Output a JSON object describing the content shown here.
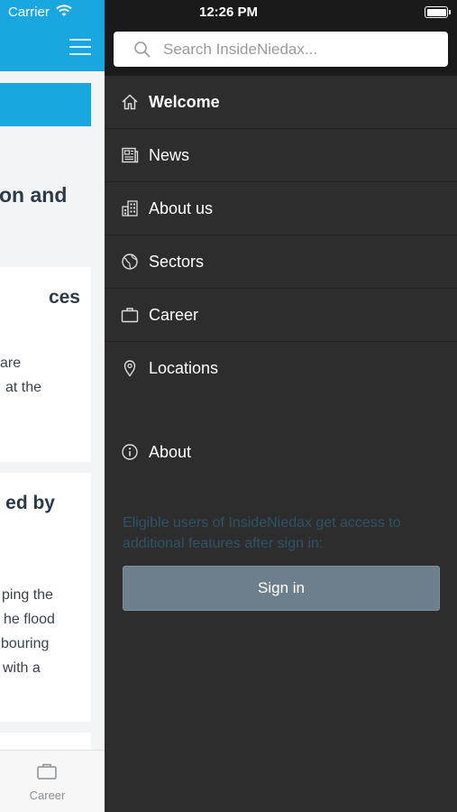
{
  "status_bar": {
    "carrier": "Carrier",
    "time": "12:26 PM"
  },
  "background_app": {
    "headline": "on and",
    "card1": {
      "title": "ces",
      "lines": [
        "are",
        "at the"
      ]
    },
    "card2": {
      "title": "ed by",
      "lines": [
        "ping the",
        "he flood",
        "bouring",
        "with a"
      ]
    },
    "tabbar": {
      "career_label": "Career"
    },
    "colors": {
      "header": "#1aa7e0"
    }
  },
  "drawer": {
    "search": {
      "placeholder": "Search InsideNiedax..."
    },
    "menu": [
      {
        "label": "Welcome",
        "icon": "home-icon"
      },
      {
        "label": "News",
        "icon": "newspaper-icon"
      },
      {
        "label": "About us",
        "icon": "buildings-icon"
      },
      {
        "label": "Sectors",
        "icon": "globe-icon"
      },
      {
        "label": "Career",
        "icon": "briefcase-icon"
      },
      {
        "label": "Locations",
        "icon": "map-pin-icon"
      }
    ],
    "about": {
      "label": "About",
      "icon": "info-icon"
    },
    "signin_note": "Eligible users of InsideNiedax get access to additional features after sign in:",
    "signin_button": "Sign in",
    "colors": {
      "background": "#2d2d2d",
      "button": "#6c7f8a"
    }
  }
}
